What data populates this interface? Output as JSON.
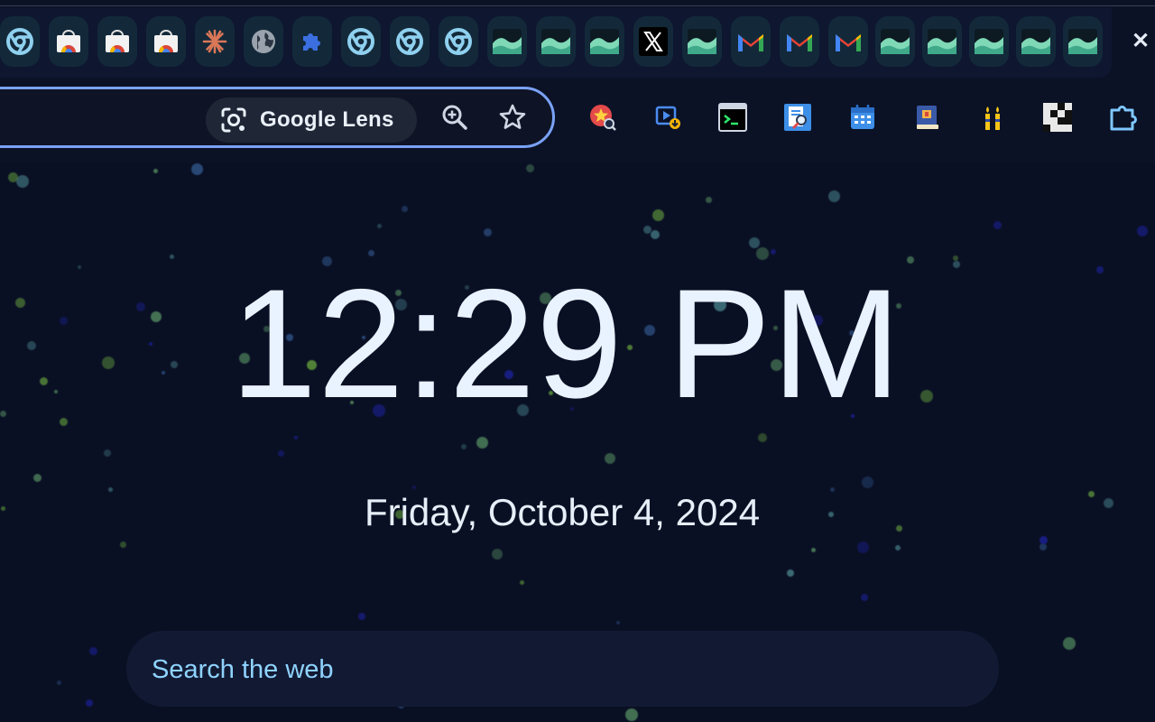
{
  "browser": {
    "tabs": [
      {
        "icon": "chrome-icon"
      },
      {
        "icon": "chrome-web-store-icon"
      },
      {
        "icon": "chrome-web-store-icon"
      },
      {
        "icon": "chrome-web-store-icon"
      },
      {
        "icon": "claude-icon"
      },
      {
        "icon": "globe-icon"
      },
      {
        "icon": "puzzle-icon"
      },
      {
        "icon": "chrome-icon"
      },
      {
        "icon": "chrome-icon"
      },
      {
        "icon": "chrome-icon"
      },
      {
        "icon": "wave-icon"
      },
      {
        "icon": "wave-icon"
      },
      {
        "icon": "wave-icon"
      },
      {
        "icon": "x-icon"
      },
      {
        "icon": "wave-icon"
      },
      {
        "icon": "gmail-icon"
      },
      {
        "icon": "gmail-icon"
      },
      {
        "icon": "gmail-icon"
      },
      {
        "icon": "wave-icon"
      },
      {
        "icon": "wave-icon"
      },
      {
        "icon": "wave-icon"
      },
      {
        "icon": "wave-icon"
      },
      {
        "icon": "wave-icon"
      }
    ],
    "close_tab_label": "✕",
    "omnibox": {
      "lens_label": "Google Lens",
      "zoom_icon": "zoom-in-icon",
      "bookmark_icon": "star-icon"
    },
    "extensions": [
      {
        "icon": "star-search-extension-icon"
      },
      {
        "icon": "video-download-extension-icon"
      },
      {
        "icon": "terminal-extension-icon"
      },
      {
        "icon": "document-search-extension-icon"
      },
      {
        "icon": "calendar-extension-icon"
      },
      {
        "icon": "book-extension-icon"
      },
      {
        "icon": "candles-extension-icon"
      },
      {
        "icon": "pixel-grid-extension-icon"
      },
      {
        "icon": "extensions-puzzle-icon"
      }
    ]
  },
  "page": {
    "time": "12:29 PM",
    "date": "Friday, October 4, 2024",
    "search_placeholder": "Search the web"
  },
  "colors": {
    "background": "#0a1024",
    "clock_text": "#e9f2ff",
    "search_placeholder": "#8fd3ff",
    "omnibox_border": "#7aa2f7"
  }
}
